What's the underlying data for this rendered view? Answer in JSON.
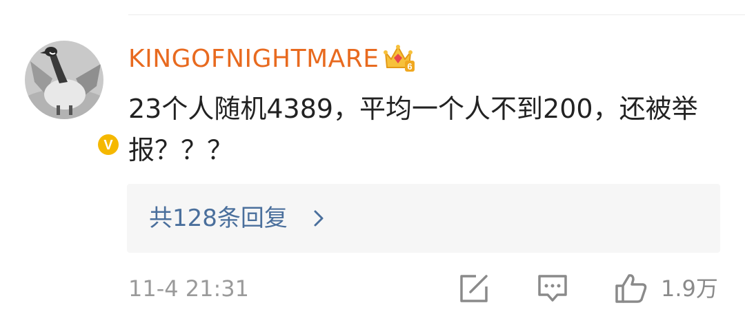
{
  "comment": {
    "username": "KINGOFNIGHTMARE",
    "level_badge": "crown-level-6-icon",
    "level_number": "6",
    "verified_badge": "verified-v-icon",
    "verified_letter": "V",
    "text": "23个人随机4389，平均一个人不到200，还被举报？？？",
    "replies_label": "共128条回复",
    "timestamp": "11-4 21:31",
    "like_count": "1.9万"
  },
  "actions": {
    "share_icon": "share-icon",
    "comment_icon": "comment-icon",
    "like_icon": "thumbs-up-icon"
  },
  "colors": {
    "username": "#e86a1f",
    "link": "#4a6f9c",
    "text": "#222222",
    "meta": "#9a9a9a",
    "verified": "#f5b800"
  }
}
